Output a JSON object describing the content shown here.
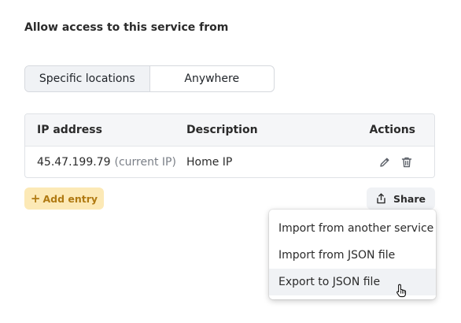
{
  "access": {
    "heading": "Allow access to this service from",
    "options": [
      "Specific locations",
      "Anywhere"
    ],
    "selected": "Specific locations"
  },
  "table": {
    "headers": {
      "ip": "IP address",
      "description": "Description",
      "actions": "Actions"
    },
    "rows": [
      {
        "ip": "45.47.199.79",
        "ip_note": "(current IP)",
        "description": "Home IP"
      }
    ]
  },
  "buttons": {
    "add_entry": "Add entry",
    "share": "Share"
  },
  "share_menu": {
    "items": [
      "Import from another service",
      "Import from JSON file",
      "Export to JSON file"
    ],
    "hovered": "Export to JSON file"
  },
  "icons": {
    "edit": "pencil-icon",
    "delete": "trash-icon",
    "share": "share-icon",
    "add": "plus-icon",
    "pointer": "hand-pointer-icon"
  },
  "colors": {
    "add_entry_bg": "#fce9b6",
    "add_entry_text": "#b07a12",
    "header_bg": "#f5f6f8"
  }
}
